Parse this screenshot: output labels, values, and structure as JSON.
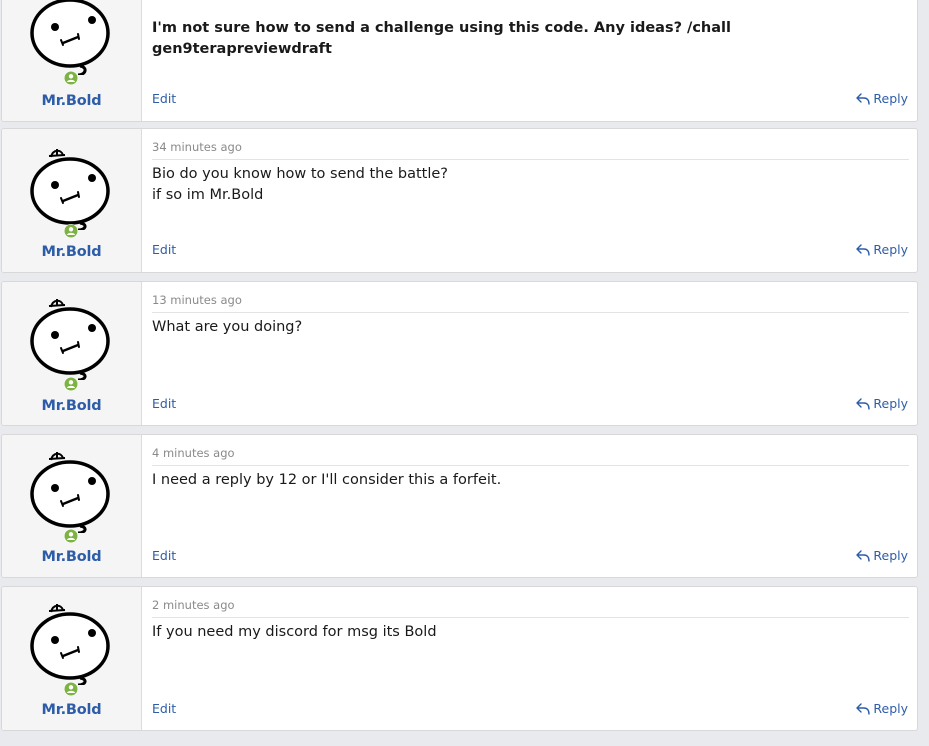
{
  "posts": [
    {
      "username": "Mr.Bold",
      "timestamp": "",
      "message": "I'm not sure how to send a challenge using this code. Any ideas? /chall gen9terapreviewdraft",
      "edit_label": "Edit",
      "reply_label": "Reply"
    },
    {
      "username": "Mr.Bold",
      "timestamp": "34 minutes ago",
      "message_lines": [
        "Bio do you know how to send the battle?",
        "if so im Mr.Bold"
      ],
      "edit_label": "Edit",
      "reply_label": "Reply"
    },
    {
      "username": "Mr.Bold",
      "timestamp": "13 minutes ago",
      "message": "What are you doing?",
      "edit_label": "Edit",
      "reply_label": "Reply"
    },
    {
      "username": "Mr.Bold",
      "timestamp": "4 minutes ago",
      "message": "I need a reply by 12 or I'll consider this a forfeit.",
      "edit_label": "Edit",
      "reply_label": "Reply"
    },
    {
      "username": "Mr.Bold",
      "timestamp": "2 minutes ago",
      "message": "If you need my discord for msg its Bold",
      "edit_label": "Edit",
      "reply_label": "Reply"
    }
  ],
  "icons": {
    "avatar": "cartoon-face-avatar-icon",
    "online_status": "online-user-icon",
    "reply": "reply-arrow-icon"
  },
  "colors": {
    "username": "#2e5da8",
    "link": "#2e5da8",
    "online": "#7cb342",
    "page_background": "#e9eaed"
  }
}
